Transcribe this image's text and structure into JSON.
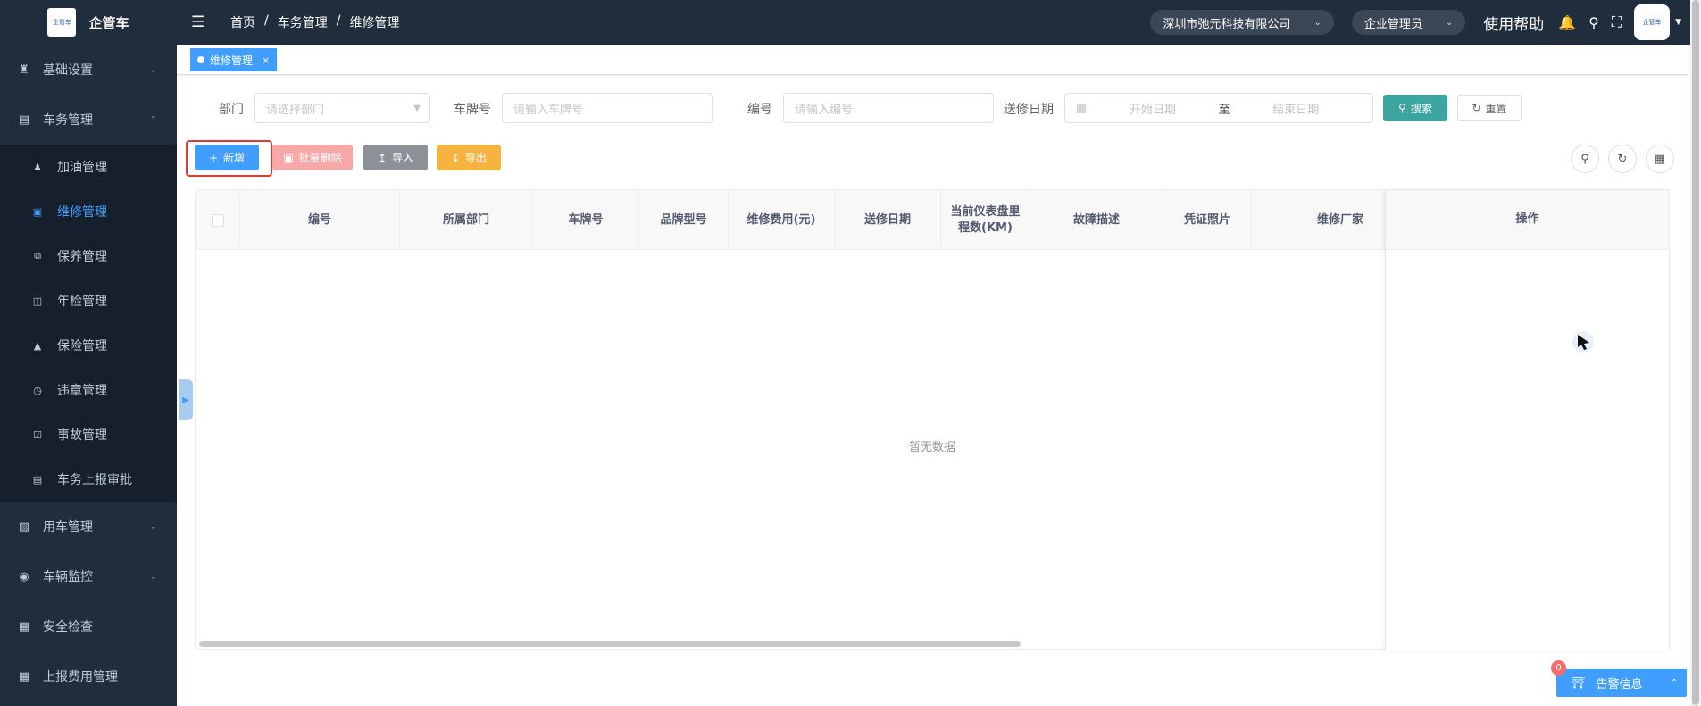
{
  "app": {
    "title": "企管车",
    "logo_text": "企管车"
  },
  "sidebar": {
    "items": [
      {
        "label": "基础设置",
        "icon": "user-group-icon",
        "expanded": false
      },
      {
        "label": "车务管理",
        "icon": "dashboard-icon",
        "expanded": true
      },
      {
        "label": "用车管理",
        "icon": "car-book-icon",
        "expanded": false
      },
      {
        "label": "车辆监控",
        "icon": "globe-icon",
        "expanded": false
      },
      {
        "label": "安全检查",
        "icon": "keyboard-icon",
        "expanded": false
      },
      {
        "label": "上报费用管理",
        "icon": "grid-icon",
        "expanded": false
      }
    ],
    "submenu": [
      {
        "label": "加油管理",
        "icon": "person-icon"
      },
      {
        "label": "维修管理",
        "icon": "toolbox-icon",
        "active": true
      },
      {
        "label": "保养管理",
        "icon": "copy-icon"
      },
      {
        "label": "年检管理",
        "icon": "id-card-icon"
      },
      {
        "label": "保险管理",
        "icon": "lock-icon"
      },
      {
        "label": "违章管理",
        "icon": "clock-icon"
      },
      {
        "label": "事故管理",
        "icon": "checkbox-icon"
      },
      {
        "label": "车务上报审批",
        "icon": "document-icon"
      }
    ]
  },
  "header": {
    "breadcrumb": [
      "首页",
      "车务管理",
      "维修管理"
    ],
    "company": "深圳市弛元科技有限公司",
    "role": "企业管理员",
    "help": "使用帮助"
  },
  "tags": [
    {
      "label": "维修管理",
      "active": true
    }
  ],
  "search": {
    "dept_label": "部门",
    "dept_placeholder": "请选择部门",
    "plate_label": "车牌号",
    "plate_placeholder": "请输入车牌号",
    "code_label": "编号",
    "code_placeholder": "请输入编号",
    "date_label": "送修日期",
    "start_placeholder": "开始日期",
    "range_sep": "至",
    "end_placeholder": "结束日期",
    "search_btn": "搜索",
    "reset_btn": "重置"
  },
  "toolbar": {
    "add": "新增",
    "batch_delete": "批量删除",
    "import": "导入",
    "export": "导出"
  },
  "table": {
    "columns": [
      "编号",
      "所属部门",
      "车牌号",
      "品牌型号",
      "维修费用(元)",
      "送修日期",
      "当前仪表盘里程数(KM)",
      "故障描述",
      "凭证照片",
      "维修厂家"
    ],
    "action_column": "操作",
    "rows": [],
    "empty_text": "暂无数据"
  },
  "alarm": {
    "label": "告警信息",
    "count": "0"
  },
  "colors": {
    "sidebar": "#1f2d3d",
    "primary": "#409eff",
    "search": "#3ca59f",
    "danger": "#f7a9a8",
    "warning": "#f6b340"
  }
}
